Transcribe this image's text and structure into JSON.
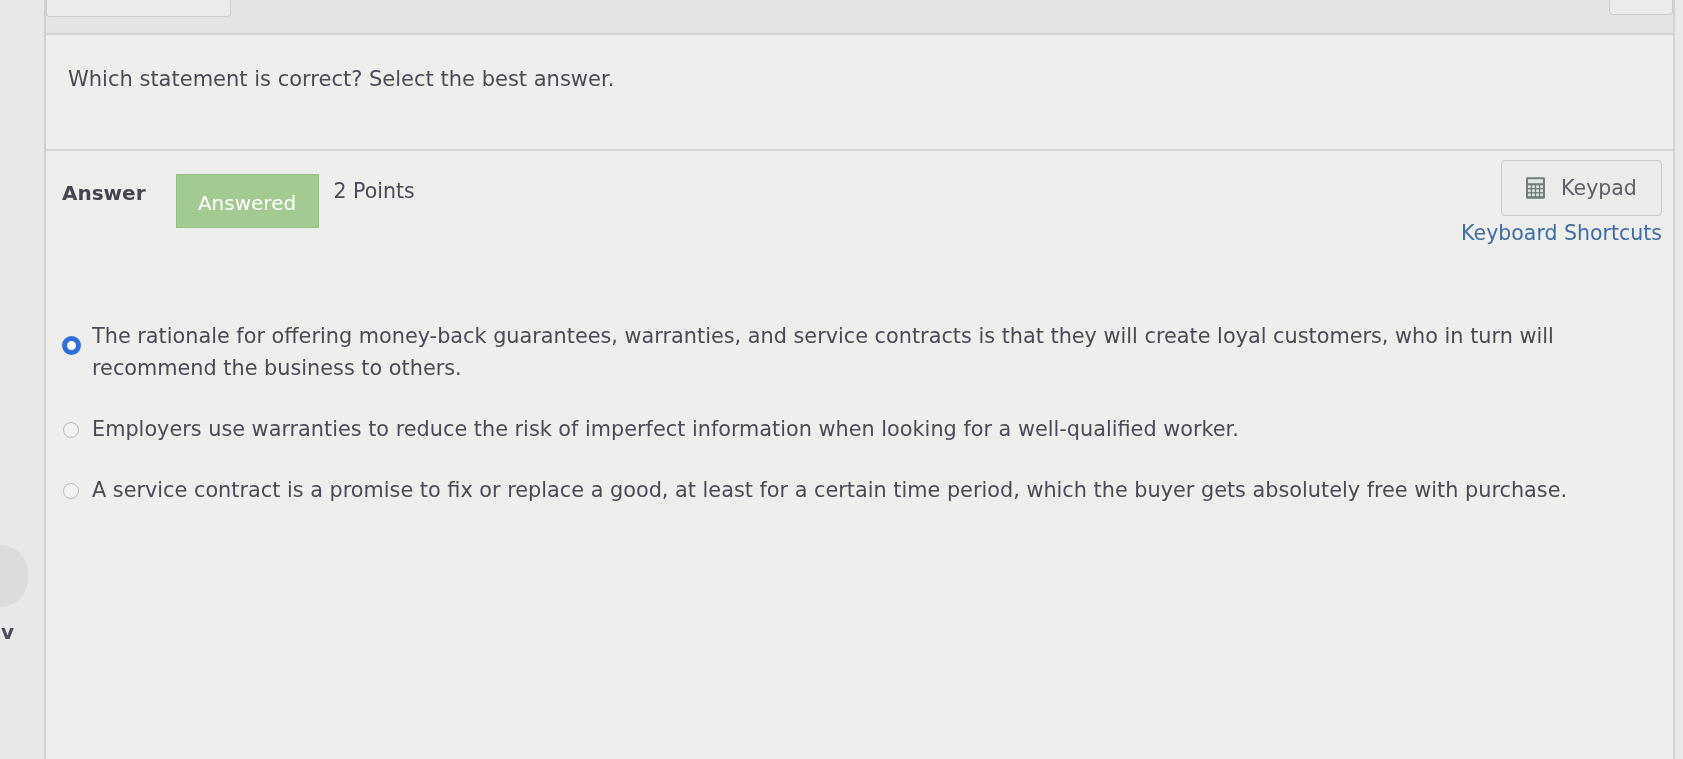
{
  "left_panel": {
    "label": "v"
  },
  "question": {
    "prompt": "Which statement is correct? Select the best answer."
  },
  "answer_bar": {
    "label": "Answer",
    "status": "Answered",
    "points": "2 Points",
    "keypad_button": "Keypad",
    "shortcuts_link": "Keyboard Shortcuts"
  },
  "options": [
    {
      "text": "The rationale for offering money-back guarantees, warranties, and service contracts is that they will create loyal customers, who in turn will recommend the business to others.",
      "selected": true
    },
    {
      "text": "Employers use warranties to reduce the risk of imperfect information when looking for a well-qualified worker.",
      "selected": false
    },
    {
      "text": "A service contract is a promise to fix or replace a good, at least for a certain time period, which the buyer gets absolutely free with purchase.",
      "selected": false
    }
  ]
}
